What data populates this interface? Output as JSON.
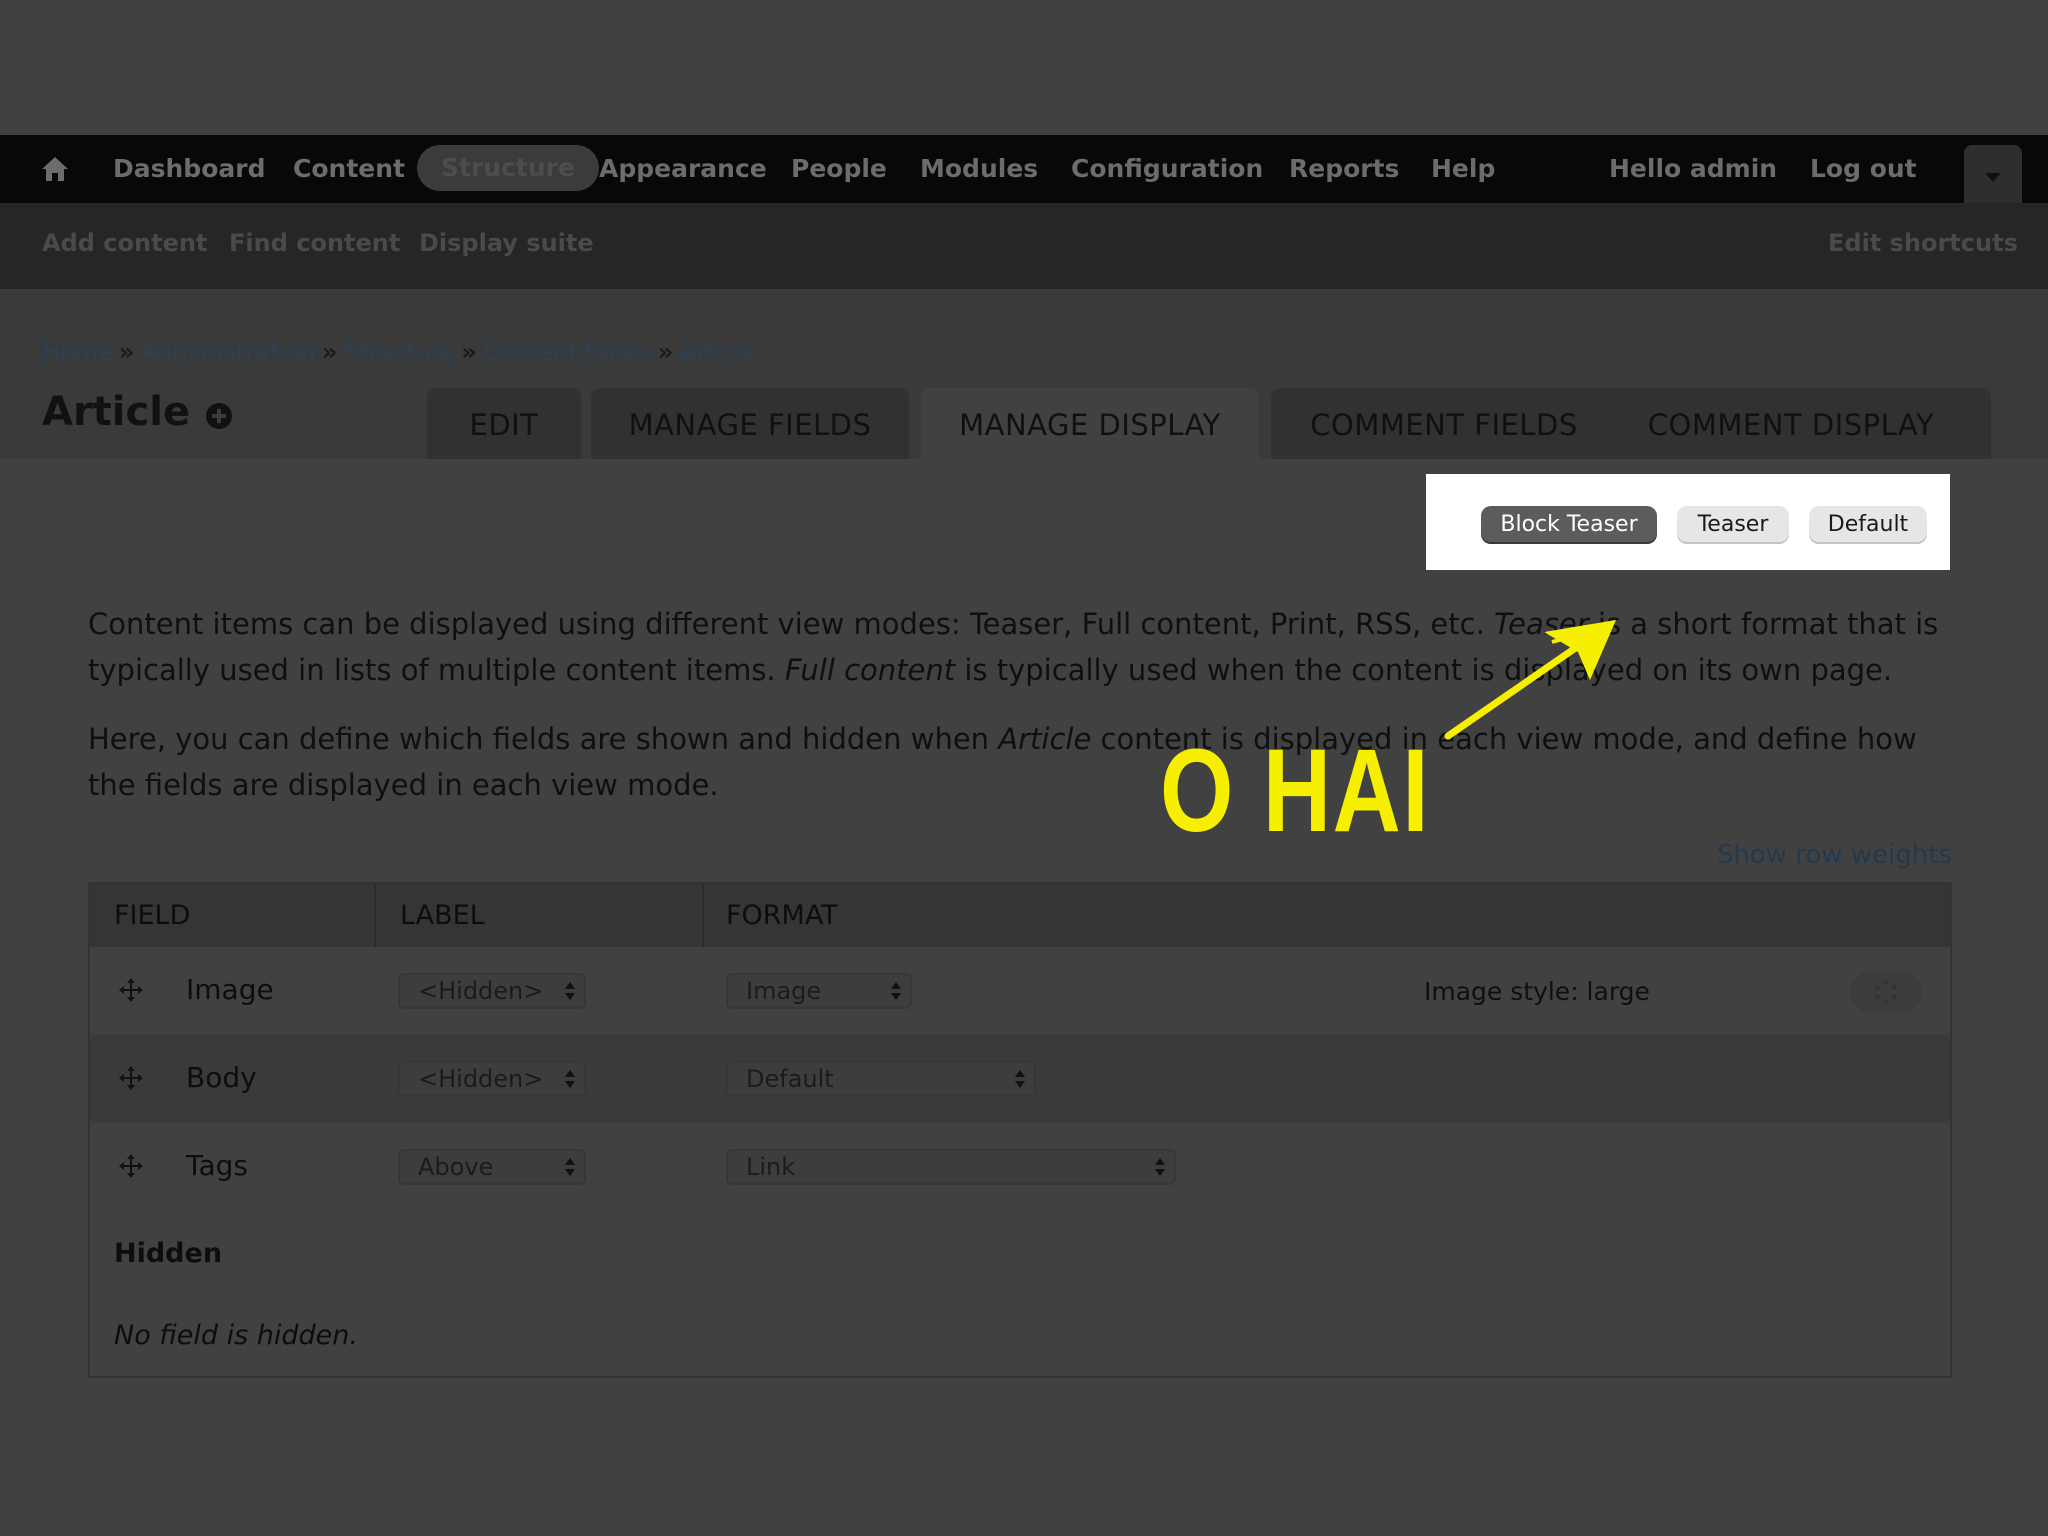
{
  "toolbar": {
    "home_icon": "home-icon",
    "items": [
      "Dashboard",
      "Content",
      "Structure",
      "Appearance",
      "People",
      "Modules",
      "Configuration",
      "Reports",
      "Help"
    ],
    "active_item": "Structure",
    "user_greeting": "Hello admin",
    "logout": "Log out",
    "drawer_icon": "chevron-down-icon"
  },
  "shortcuts": {
    "items": [
      "Add content",
      "Find content",
      "Display suite"
    ],
    "edit": "Edit shortcuts"
  },
  "breadcrumb": [
    "Home",
    "Administration",
    "Structure",
    "Content types",
    "Article"
  ],
  "breadcrumb_separator": "»",
  "page": {
    "title": "Article",
    "add_icon": "plus-circle-icon"
  },
  "tabs": [
    "EDIT",
    "MANAGE FIELDS",
    "MANAGE DISPLAY",
    "COMMENT FIELDS",
    "COMMENT DISPLAY"
  ],
  "active_tab": "MANAGE DISPLAY",
  "view_modes": [
    "Block Teaser",
    "Teaser",
    "Default"
  ],
  "active_view_mode": "Block Teaser",
  "description": {
    "p1_a": "Content items can be displayed using different view modes: Teaser, Full content, Print, RSS, etc. ",
    "p1_em1": "Teaser",
    "p1_b": " is a short format that is typically used in lists of multiple content items. ",
    "p1_em2": "Full content",
    "p1_c": " is typically used when the content is displayed on its own page.",
    "p2_a": "Here, you can define which fields are shown and hidden when ",
    "p2_em": "Article",
    "p2_b": " content is displayed in each view mode, and define how the fields are displayed in each view mode."
  },
  "annotation": {
    "text": "O HAI",
    "color": "#f7ef00"
  },
  "show_row_weights": "Show row weights",
  "table": {
    "headers": [
      "FIELD",
      "LABEL",
      "FORMAT"
    ],
    "rows": [
      {
        "field": "Image",
        "label": "<Hidden>",
        "format": "Image",
        "summary": "Image style: large",
        "has_settings": true
      },
      {
        "field": "Body",
        "label": "<Hidden>",
        "format": "Default",
        "summary": "",
        "has_settings": false
      },
      {
        "field": "Tags",
        "label": "Above",
        "format": "Link",
        "summary": "",
        "has_settings": false
      }
    ],
    "hidden_title": "Hidden",
    "hidden_empty": "No field is hidden."
  }
}
